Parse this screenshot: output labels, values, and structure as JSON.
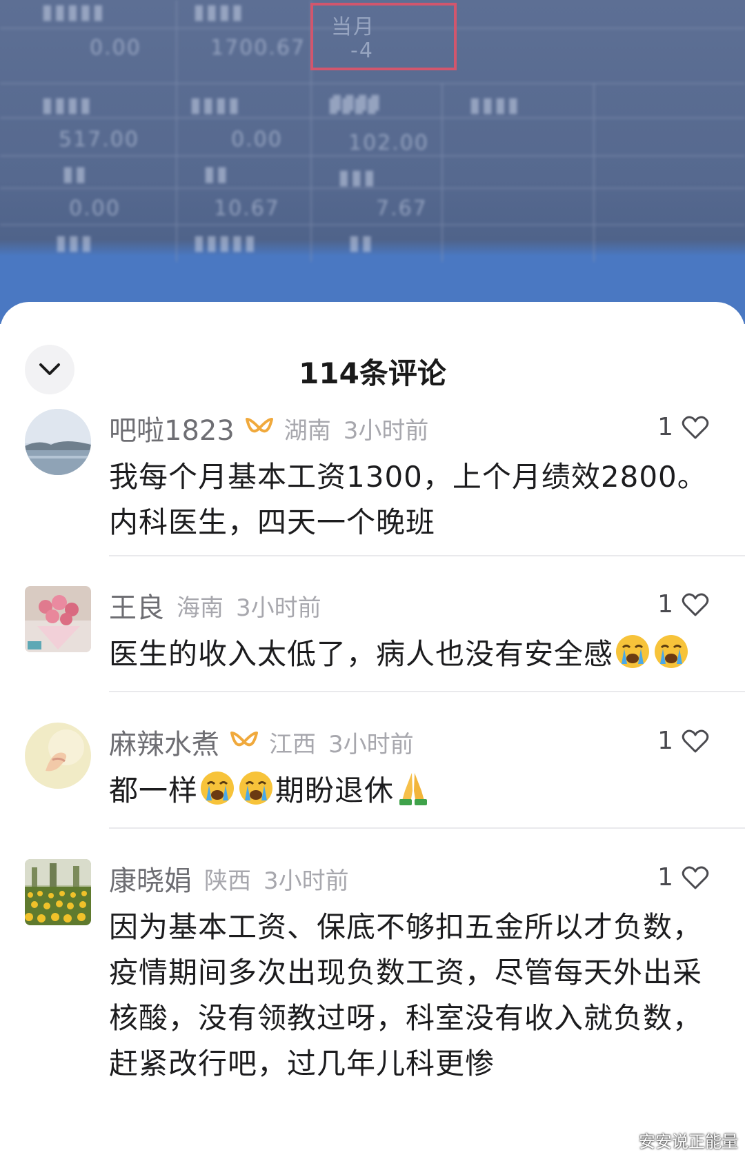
{
  "sheet": {
    "title": "114条评论"
  },
  "comments": [
    {
      "username": "吧啦1823",
      "vip": true,
      "region": "湖南",
      "time": "3小时前",
      "likes": "1",
      "text": "我每个月基本工资1300，上个月绩效2800。内科医生，四天一个晚班",
      "avatar": "lake-landscape"
    },
    {
      "username": "王良",
      "vip": false,
      "region": "海南",
      "time": "3小时前",
      "likes": "1",
      "text": "医生的收入太低了，病人也没有安全感",
      "emojis": [
        "loudly-crying-face",
        "loudly-crying-face"
      ],
      "avatar": "pink-bouquet"
    },
    {
      "username": "麻辣水煮",
      "vip": true,
      "region": "江西",
      "time": "3小时前",
      "likes": "1",
      "text_before": "都一样",
      "text_after": "期盼退休",
      "emojis": [
        "loudly-crying-face",
        "loudly-crying-face",
        "folded-hands"
      ],
      "avatar": "hands-soft-yellow"
    },
    {
      "username": "康晓娟",
      "vip": false,
      "region": "陕西",
      "time": "3小时前",
      "likes": "1",
      "text": "因为基本工资、保底不够扣五金所以才负数，疫情期间多次出现负数工资，尽管每天外出采核酸，没有领教过呀，科室没有收入就负数，赶紧改行吧，过几年儿科更惨",
      "avatar": "tulip-field"
    }
  ],
  "background": {
    "cells": [
      "当月",
      "-4"
    ]
  },
  "watermark": "安安说正能量",
  "colors": {
    "vip_badge": "#f0a93c",
    "meta_gray": "#a7a7ad",
    "username_gray": "#6e6e73"
  }
}
